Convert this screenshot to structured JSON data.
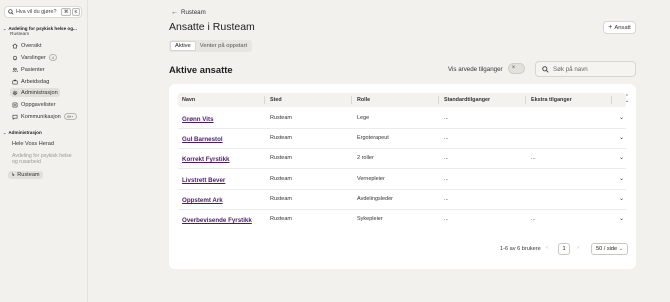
{
  "sidebar": {
    "search_placeholder": "Hva vil du gjøre?",
    "kbd_cmd": "⌘",
    "kbd_k": "K",
    "org_group": {
      "title": "Avdeling for psykisk helse og...",
      "subtitle": "Rusteam"
    },
    "items": [
      {
        "label": "Oversikt",
        "icon": "house-icon"
      },
      {
        "label": "Varslinger",
        "icon": "bell-icon",
        "badge": "4"
      },
      {
        "label": "Pasienter",
        "icon": "users-icon"
      },
      {
        "label": "Arbeidsdag",
        "icon": "briefcase-icon"
      },
      {
        "label": "Administrasjon",
        "icon": "gear-icon",
        "active": true
      },
      {
        "label": "Oppgavelister",
        "icon": "list-icon"
      },
      {
        "label": "Kommunikasjon",
        "icon": "chat-icon",
        "badge": "99+"
      }
    ],
    "admin_group": {
      "title": "Administrasjon",
      "items": [
        {
          "label": "Hele Voss Herad"
        },
        {
          "label": "Avdeling for psykisk helse og rusarbeid"
        },
        {
          "label": "Rusteam",
          "active": true
        }
      ]
    }
  },
  "header": {
    "back_label": "Rusteam",
    "title": "Ansatte i Rusteam",
    "add_label": "Ansatt"
  },
  "tabs": [
    {
      "label": "Aktive",
      "active": true
    },
    {
      "label": "Venter på oppstart",
      "active": false
    }
  ],
  "section": {
    "title": "Aktive ansatte",
    "toggle_label": "Vis arvede tilganger",
    "search_placeholder": "Søk på navn"
  },
  "table": {
    "columns": [
      "Navn",
      "Sted",
      "Rolle",
      "Standardtilganger",
      "Ekstra tilganger"
    ],
    "rows": [
      {
        "name": "Grønn Vits",
        "sted": "Rusteam",
        "rolle": "Lege",
        "standard": "...",
        "ekstra": ""
      },
      {
        "name": "Gul Barnestol",
        "sted": "Rusteam",
        "rolle": "Ergoterapeut",
        "standard": "...",
        "ekstra": ""
      },
      {
        "name": "Korrekt Fyrstikk",
        "sted": "Rusteam",
        "rolle": "2 roller",
        "standard": "...",
        "ekstra": "..."
      },
      {
        "name": "Livstrett Bever",
        "sted": "Rusteam",
        "rolle": "Vernepleier",
        "standard": "...",
        "ekstra": ""
      },
      {
        "name": "Oppstemt Ark",
        "sted": "Rusteam",
        "rolle": "Avdelingsleder",
        "standard": "...",
        "ekstra": ""
      },
      {
        "name": "Overbevisende Fyrstikk",
        "sted": "Rusteam",
        "rolle": "Sykepleier",
        "standard": "...",
        "ekstra": "..."
      }
    ]
  },
  "pagination": {
    "range": "1-6 av 6 brukere",
    "current_page": "1",
    "page_size": "50 / side"
  },
  "colors": {
    "accent_name": "#4a1d63",
    "background": "#f2f1ee"
  }
}
